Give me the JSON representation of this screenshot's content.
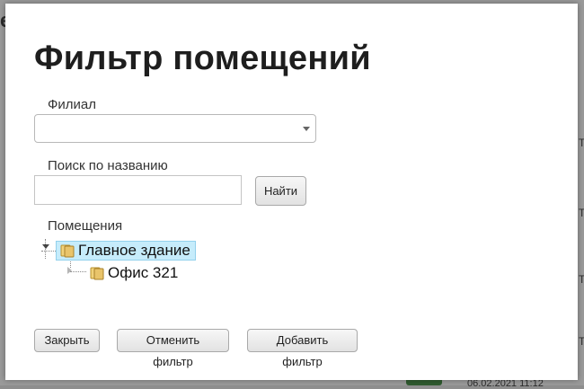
{
  "dialog": {
    "title": "Фильтр помещений",
    "branch": {
      "label": "Филиал",
      "value": ""
    },
    "search": {
      "label": "Поиск по названию",
      "value": "",
      "button": "Найти"
    },
    "rooms": {
      "label": "Помещения",
      "tree": [
        {
          "label": "Главное здание",
          "expanded": true,
          "selected": true,
          "children": [
            {
              "label": "Офис 321"
            }
          ]
        }
      ]
    },
    "buttons": {
      "close": "Закрыть",
      "cancel_filter": "Отменить фильтр",
      "add_filter": "Добавить фильтр"
    }
  },
  "background": {
    "fragments": [
      "е",
      "е",
      "Т",
      "Т",
      "Т",
      "Т",
      "Т",
      "06.02.2021 11:12"
    ]
  },
  "colors": {
    "overlay": "#9a9a9a",
    "modal": "#ffffff",
    "selected_node": "#c6ecfb",
    "folder": "#e9c46a"
  }
}
